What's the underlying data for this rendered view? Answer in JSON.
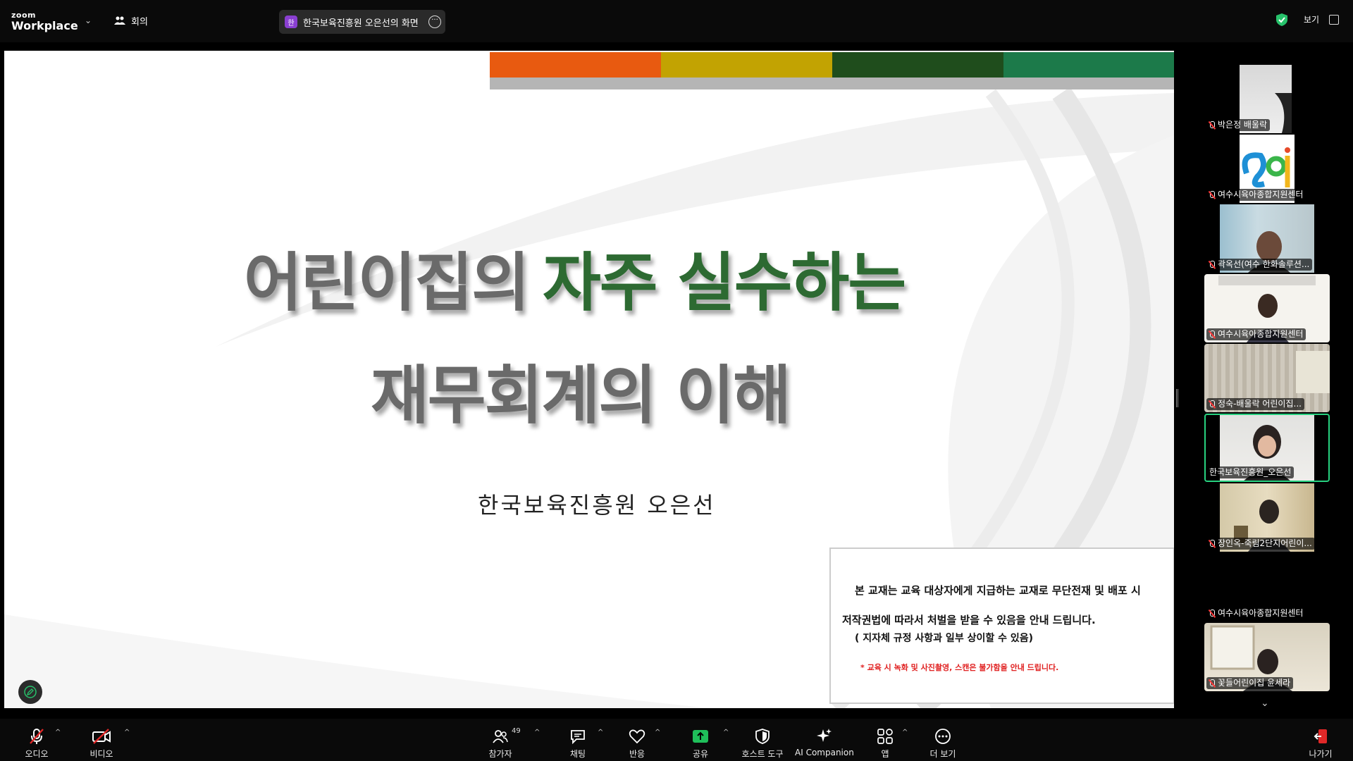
{
  "topbar": {
    "brand_small": "zoom",
    "brand_main": "Workplace",
    "meeting_label": "회의",
    "share_avatar": "한",
    "share_label": "한국보육진흥원 오은선의 화면",
    "view_label": "보기",
    "colors": {
      "shield": "#27c26b",
      "share_avatar_bg": "#8a3fd1"
    }
  },
  "slide": {
    "title_line1_gray": "어린이집의",
    "title_line1_green": "자주 실수하는",
    "title_line2": "재무회계의 이해",
    "presenter": "한국보육진흥원 오은선",
    "notice": {
      "line1": "본 교재는 교육 대상자에게 지급하는 교재로 무단전재 및 배포 시",
      "line2": "저작권법에 따라서 처벌을 받을 수 있음을 안내 드립니다.",
      "line3": "( 지자체 규정 사항과 일부 상이할 수 있음)",
      "line4": "* 교육 시 녹화 및 사진촬영, 스캔은 불가함을 안내 드립니다."
    },
    "bar_colors": [
      "#e85a10",
      "#c2a302",
      "#1f4d1c",
      "#1c7a4a"
    ],
    "title_gray_color": "#6a6a6a",
    "title_green_color": "#2d6a32"
  },
  "participants": [
    {
      "name": "박은정 배울락",
      "muted": true
    },
    {
      "name": "여수시육아종합지원센터",
      "muted": true
    },
    {
      "name": "곽옥선(여수 한화솔루션...",
      "muted": true
    },
    {
      "name": "여수시육아종합지원센터",
      "muted": true
    },
    {
      "name": "정숙-배울락 어린이집...",
      "muted": true
    },
    {
      "name": "한국보육진흥원_오은선",
      "muted": false,
      "active": true
    },
    {
      "name": "장인옥-죽림2단지어린이...",
      "muted": true
    },
    {
      "name": "여수시육아종합지원센터",
      "muted": true
    },
    {
      "name": "꽃들어린이집 윤세라",
      "muted": true
    }
  ],
  "toolbar": {
    "audio": "오디오",
    "video": "비디오",
    "participants": "참가자",
    "participants_count": "49",
    "chat": "채팅",
    "reactions": "반응",
    "share": "공유",
    "host_tools": "호스트 도구",
    "ai_companion": "AI Companion",
    "apps": "앱",
    "more": "더 보기",
    "leave": "나가기",
    "colors": {
      "share_green": "#1fbf5a",
      "leave_red": "#e02828",
      "muted_red": "#e02828"
    }
  }
}
